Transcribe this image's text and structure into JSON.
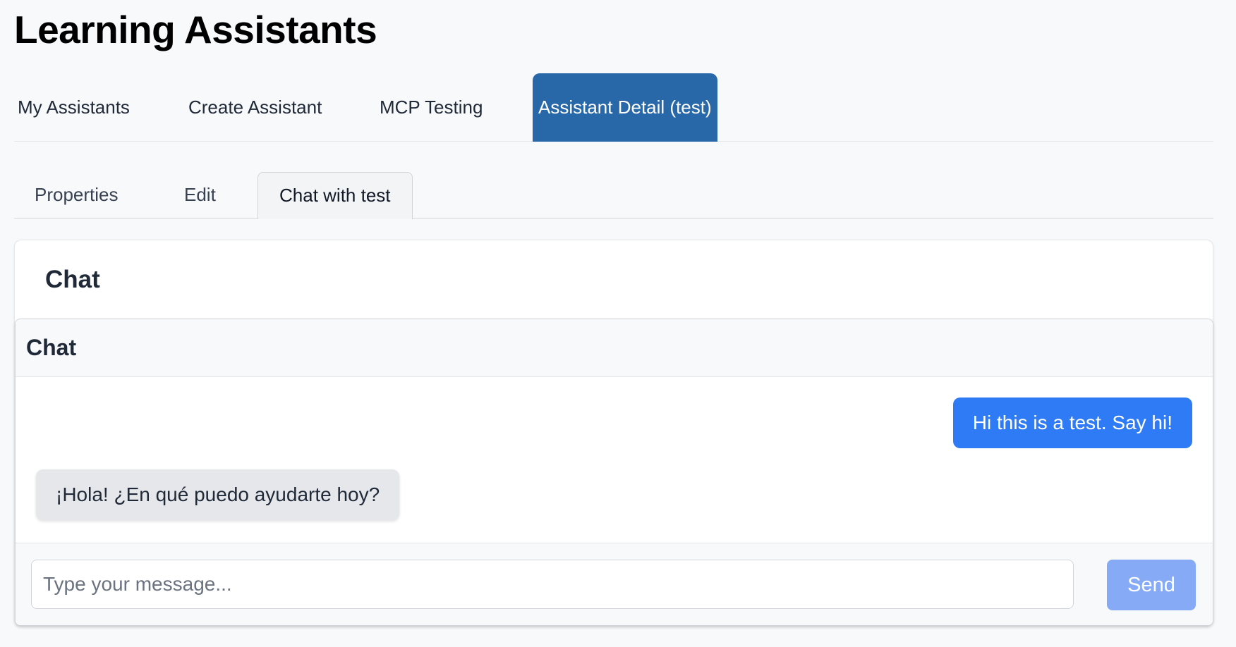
{
  "app": {
    "title": "Learning Assistants"
  },
  "top_tabs": {
    "items": [
      {
        "label": "My Assistants"
      },
      {
        "label": "Create Assistant"
      },
      {
        "label": "MCP Testing"
      },
      {
        "label": "Assistant Detail (test)",
        "active": true
      }
    ]
  },
  "sub_tabs": {
    "items": [
      {
        "label": "Properties"
      },
      {
        "label": "Edit"
      },
      {
        "label": "Chat with test",
        "active": true
      }
    ]
  },
  "card": {
    "title": "Chat"
  },
  "chat": {
    "header_title": "Chat",
    "messages": [
      {
        "role": "user",
        "text": "Hi this is a test. Say hi!"
      },
      {
        "role": "assistant",
        "text": "¡Hola! ¿En qué puedo ayudarte hoy?"
      }
    ],
    "input": {
      "value": "",
      "placeholder": "Type your message..."
    },
    "send_label": "Send"
  },
  "colors": {
    "active_tab": "#2968a8",
    "user_bubble": "#2f7bf5",
    "assistant_bubble": "#e5e7eb",
    "send_button_disabled": "#86aaf5",
    "page_background": "#f8f9fb"
  }
}
